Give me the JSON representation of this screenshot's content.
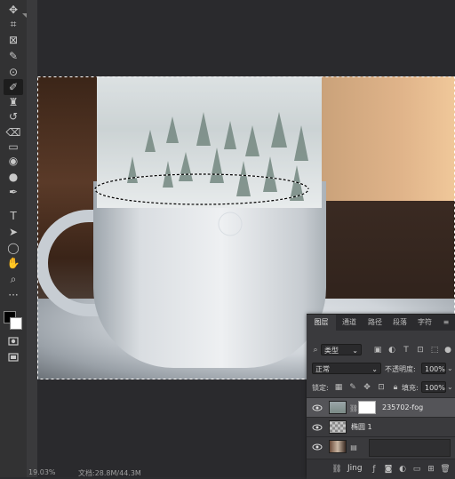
{
  "toolbar": {
    "tools": [
      {
        "name": "move-tool-icon",
        "glyph": "✥"
      },
      {
        "name": "crop-tool-icon",
        "glyph": "⌗"
      },
      {
        "name": "frame-tool-icon",
        "glyph": "⊠"
      },
      {
        "name": "eyedropper-tool-icon",
        "glyph": "✎"
      },
      {
        "name": "patch-tool-icon",
        "glyph": "⊙"
      },
      {
        "name": "brush-tool-icon",
        "glyph": "✐"
      },
      {
        "name": "clone-stamp-tool-icon",
        "glyph": "♜"
      },
      {
        "name": "history-brush-tool-icon",
        "glyph": "↺"
      },
      {
        "name": "eraser-tool-icon",
        "glyph": "⌫"
      },
      {
        "name": "gradient-tool-icon",
        "glyph": "▭"
      },
      {
        "name": "blur-tool-icon",
        "glyph": "◉"
      },
      {
        "name": "dodge-tool-icon",
        "glyph": "●"
      },
      {
        "name": "pen-tool-icon",
        "glyph": "✒"
      },
      {
        "name": "type-tool-icon",
        "glyph": "T"
      },
      {
        "name": "path-select-tool-icon",
        "glyph": "➤"
      },
      {
        "name": "shape-tool-icon",
        "glyph": "◯"
      },
      {
        "name": "hand-tool-icon",
        "glyph": "✋"
      },
      {
        "name": "zoom-tool-icon",
        "glyph": "⌕"
      },
      {
        "name": "more-tools-icon",
        "glyph": "···"
      }
    ],
    "foreground_color": "#000000",
    "background_color": "#ffffff"
  },
  "status": {
    "zoom": "19.03%",
    "doc_info": "文档:28.8M/44.3M"
  },
  "layers_panel": {
    "tabs": [
      "图层",
      "通道",
      "路径",
      "段落",
      "字符"
    ],
    "filter_kind": "类型",
    "blend_mode": "正常",
    "opacity_label": "不透明度:",
    "opacity_value": "100%",
    "lock_label": "锁定:",
    "fill_label": "填充:",
    "fill_value": "100%",
    "layers": [
      {
        "name": "235702-fog",
        "selected": true
      },
      {
        "name": "椭圆 1",
        "selected": false
      },
      {
        "name": "",
        "selected": false
      }
    ],
    "watermark": "Jing"
  }
}
